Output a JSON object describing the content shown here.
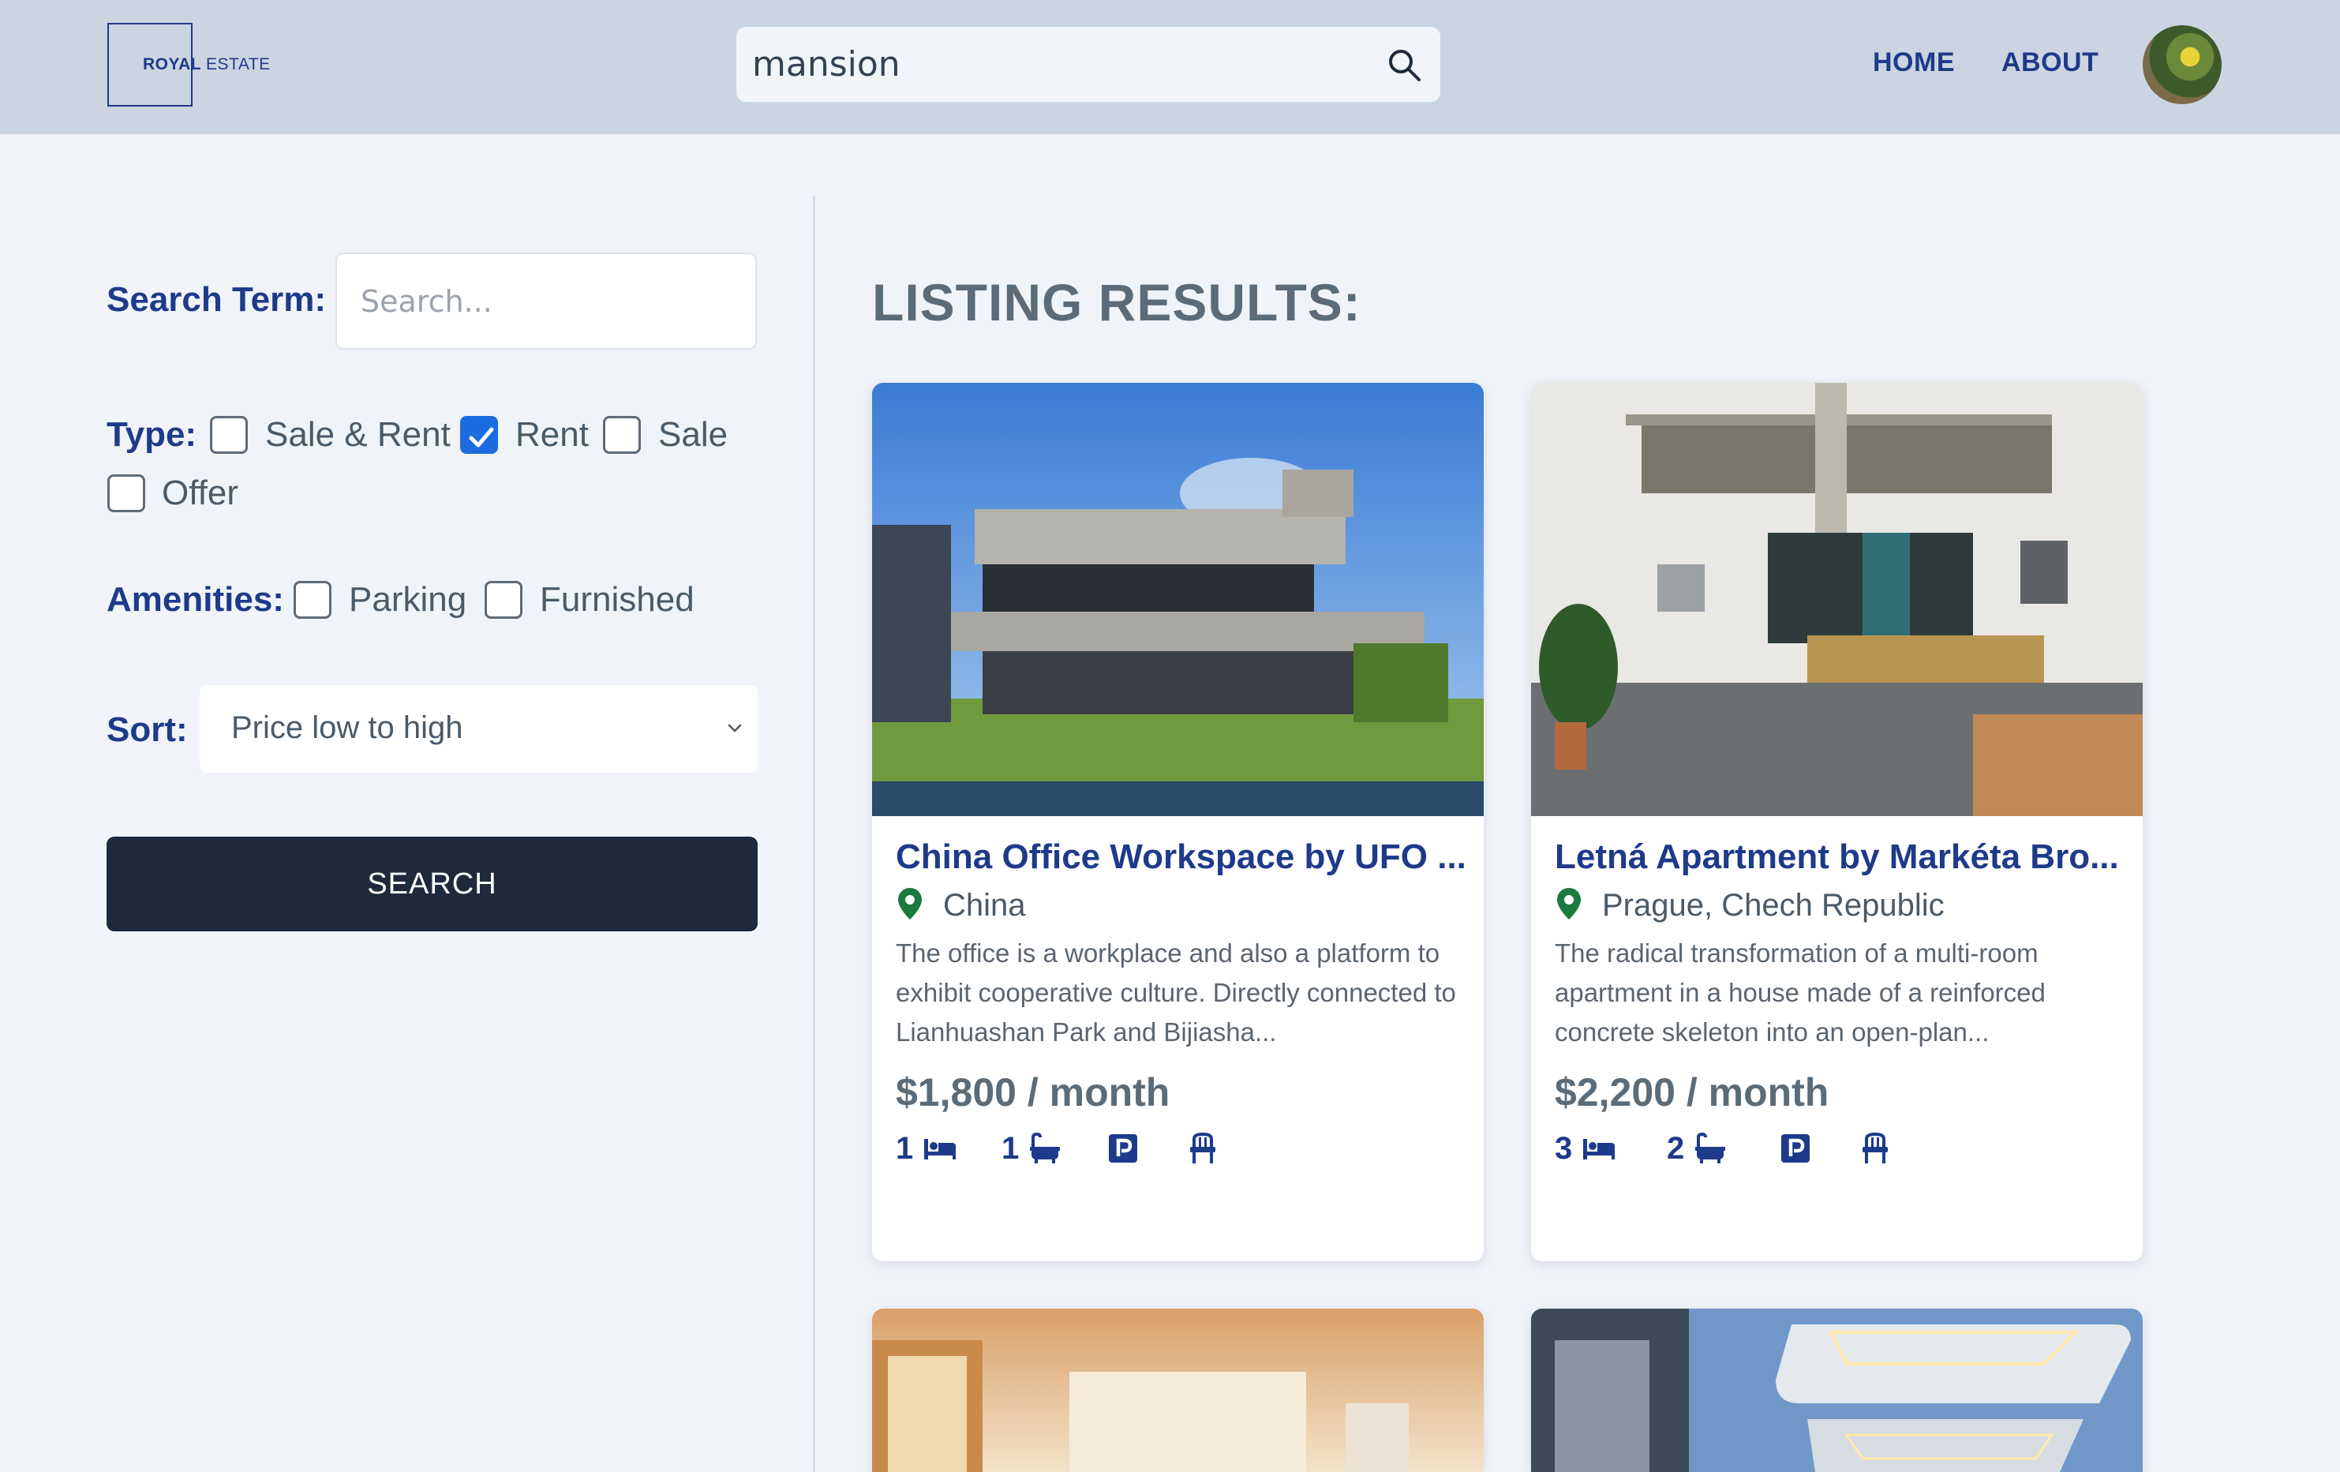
{
  "header": {
    "logo": {
      "royal": "ROYAL",
      "estate": "ESTATE"
    },
    "search": {
      "value": "mansion"
    },
    "nav": [
      {
        "label": "HOME"
      },
      {
        "label": "ABOUT"
      }
    ]
  },
  "sidebar": {
    "search_term": {
      "label": "Search Term:",
      "placeholder": "Search..."
    },
    "type": {
      "label": "Type:",
      "options": [
        {
          "label": "Sale & Rent",
          "checked": false
        },
        {
          "label": "Rent",
          "checked": true
        },
        {
          "label": "Sale",
          "checked": false
        },
        {
          "label": "Offer",
          "checked": false
        }
      ]
    },
    "amenities": {
      "label": "Amenities:",
      "options": [
        {
          "label": "Parking",
          "checked": false
        },
        {
          "label": "Furnished",
          "checked": false
        }
      ]
    },
    "sort": {
      "label": "Sort:",
      "selected": "Price low to high"
    },
    "search_button": "SEARCH"
  },
  "results": {
    "title": "LISTING RESULTS:",
    "listings": [
      {
        "title": "China Office Workspace by UFO ...",
        "location": "China",
        "description": "The office is a workplace and also a platform to exhibit cooperative culture. Directly connected to Lianhuashan Park and Bijiasha...",
        "price": "$1,800 / month",
        "beds": "1",
        "baths": "1"
      },
      {
        "title": "Letná Apartment by Markéta Bro...",
        "location": "Prague, Chech Republic",
        "description": "The radical transformation of a multi-room apartment in a house made of a reinforced concrete skeleton into an open-plan...",
        "price": "$2,200 / month",
        "beds": "3",
        "baths": "2"
      }
    ]
  },
  "colors": {
    "header_bg": "#cbd5e1",
    "page_bg": "#f0f4f9",
    "brand": "#1e3a8a",
    "button_dark": "#1e293b",
    "checkbox_checked": "#1d6be0",
    "pin_green": "#1b7a3e"
  },
  "icons": [
    "search-icon",
    "location-pin-icon",
    "bed-icon",
    "bath-icon",
    "parking-icon",
    "chair-icon",
    "chevron-down-icon",
    "checkmark-icon"
  ]
}
